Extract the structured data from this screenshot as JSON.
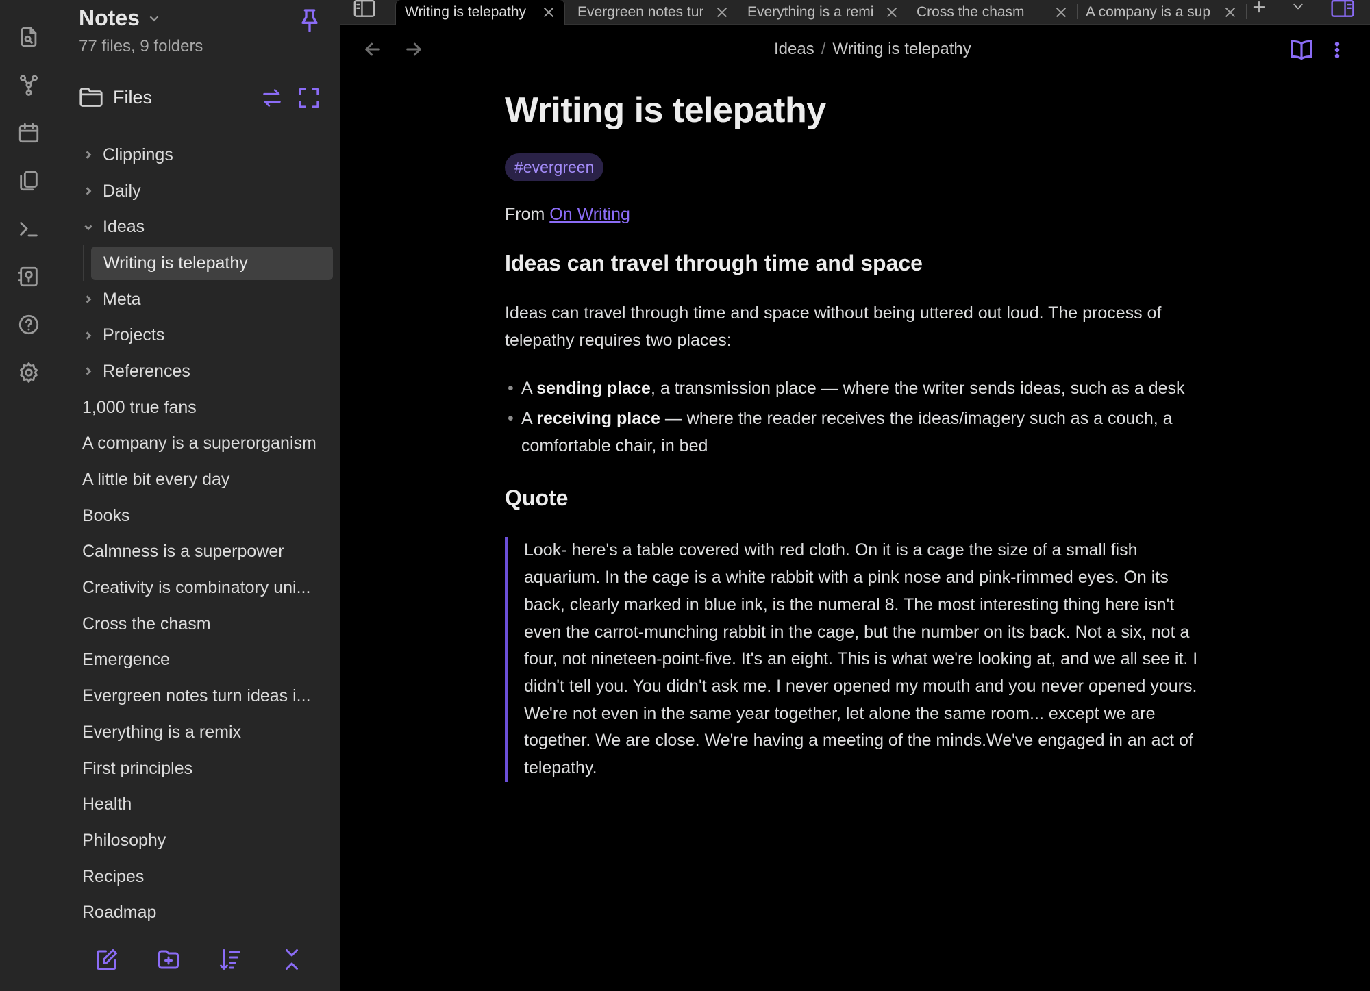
{
  "sidebar": {
    "vault_name": "Notes",
    "vault_stats": "77 files, 9 folders",
    "files_label": "Files",
    "tree": [
      {
        "label": "Clippings",
        "kind": "folder"
      },
      {
        "label": "Daily",
        "kind": "folder"
      },
      {
        "label": "Ideas",
        "kind": "folder-open"
      },
      {
        "label": "Writing is telepathy",
        "kind": "child-active"
      },
      {
        "label": "Meta",
        "kind": "folder"
      },
      {
        "label": "Projects",
        "kind": "folder"
      },
      {
        "label": "References",
        "kind": "folder"
      },
      {
        "label": "1,000 true fans",
        "kind": "file"
      },
      {
        "label": "A company is a superorganism",
        "kind": "file"
      },
      {
        "label": "A little bit every day",
        "kind": "file"
      },
      {
        "label": "Books",
        "kind": "file"
      },
      {
        "label": "Calmness is a superpower",
        "kind": "file"
      },
      {
        "label": "Creativity is combinatory uni...",
        "kind": "file"
      },
      {
        "label": "Cross the chasm",
        "kind": "file"
      },
      {
        "label": "Emergence",
        "kind": "file"
      },
      {
        "label": "Evergreen notes turn ideas i...",
        "kind": "file"
      },
      {
        "label": "Everything is a remix",
        "kind": "file"
      },
      {
        "label": "First principles",
        "kind": "file"
      },
      {
        "label": "Health",
        "kind": "file"
      },
      {
        "label": "Philosophy",
        "kind": "file"
      },
      {
        "label": "Recipes",
        "kind": "file"
      },
      {
        "label": "Roadmap",
        "kind": "file"
      }
    ]
  },
  "tabs": [
    {
      "label": "Writing is telepathy",
      "active": true
    },
    {
      "label": "Evergreen notes tur",
      "active": false
    },
    {
      "label": "Everything is a remi",
      "active": false
    },
    {
      "label": "Cross the chasm",
      "active": false
    },
    {
      "label": "A company is a sup",
      "active": false
    }
  ],
  "breadcrumb": {
    "folder": "Ideas",
    "separator": "/",
    "note": "Writing is telepathy"
  },
  "note": {
    "title": "Writing is telepathy",
    "tag": "#evergreen",
    "from_prefix": "From",
    "from_link": "On Writing",
    "heading1": "Ideas can travel through time and space",
    "paragraph": "Ideas can travel through time and space without being uttered out loud. The process of telepathy requires two places:",
    "bullets": [
      {
        "pre": "A ",
        "bold": "sending place",
        "post": ", a transmission place — where the writer sends ideas, such as a desk"
      },
      {
        "pre": "A ",
        "bold": "receiving place",
        "post": " — where the reader receives the ideas/imagery such as a couch, a comfortable chair, in bed"
      }
    ],
    "heading2": "Quote",
    "quote": "Look- here's a table covered with red cloth. On it is a cage the size of a small fish aquarium. In the cage is a white rabbit with a pink nose and pink-rimmed eyes. On its back, clearly marked in blue ink, is the numeral 8. The most interesting thing here isn't even the carrot-munching rabbit in the cage, but the number on its back. Not a six, not a four, not nineteen-point-five. It's an eight. This is what we're looking at, and we all see it. I didn't tell you. You didn't ask me. I never opened my mouth and you never opened yours. We're not even in the same year together, let alone the same room... except we are together. We are close. We're having a meeting of the minds.We've engaged in an act of telepathy."
  },
  "colors": {
    "accent": "#8b6cf6",
    "sidebar_bg": "#262626",
    "content_bg": "#000000",
    "tag_bg": "#2a2247"
  },
  "icons": {
    "ribbon": [
      "open-quick-switcher-icon",
      "graph-view-icon",
      "daily-note-calendar-icon",
      "templates-icon",
      "command-palette-icon",
      "vault-switcher-icon",
      "help-icon",
      "settings-icon"
    ],
    "sidebar_footer": [
      "new-note-icon",
      "new-folder-icon",
      "sort-icon",
      "collapse-all-icon"
    ]
  }
}
